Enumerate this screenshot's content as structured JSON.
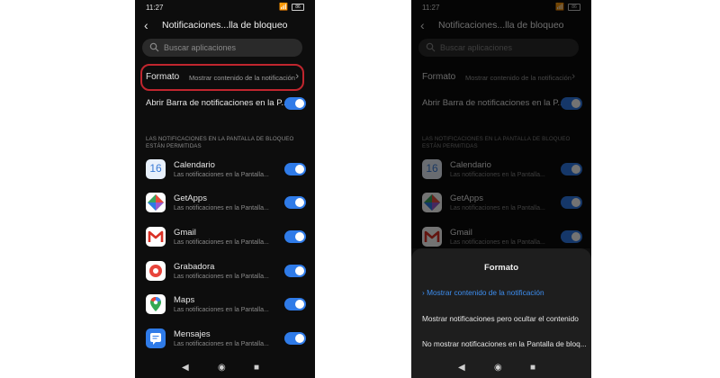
{
  "status": {
    "time": "11:27",
    "battery": "86"
  },
  "screen": {
    "title": "Notificaciones...lla de bloqueo",
    "search_placeholder": "Buscar aplicaciones",
    "formato_label": "Formato",
    "formato_value": "Mostrar contenido de la notificación",
    "open_bar_label": "Abrir Barra de notificaciones en la P...",
    "section_header": "LAS NOTIFICACIONES EN LA PANTALLA DE BLOQUEO ESTÁN PERMITIDAS",
    "apps": [
      {
        "name": "Calendario",
        "subtitle": "Las notificaciones en la Pantalla...",
        "enabled": true
      },
      {
        "name": "GetApps",
        "subtitle": "Las notificaciones en la Pantalla...",
        "enabled": true
      },
      {
        "name": "Gmail",
        "subtitle": "Las notificaciones en la Pantalla...",
        "enabled": true
      },
      {
        "name": "Grabadora",
        "subtitle": "Las notificaciones en la Pantalla...",
        "enabled": true
      },
      {
        "name": "Maps",
        "subtitle": "Las notificaciones en la Pantalla...",
        "enabled": true
      },
      {
        "name": "Mensajes",
        "subtitle": "Las notificaciones en la Pantalla...",
        "enabled": true
      }
    ],
    "calendar_day": "16"
  },
  "sheet": {
    "title": "Formato",
    "options": [
      "Mostrar contenido de la notificación",
      "Mostrar notificaciones pero ocultar el contenido",
      "No mostrar notificaciones en la Pantalla de bloq..."
    ],
    "selected_index": 0
  },
  "colors": {
    "accent": "#2f7be8",
    "highlight_box": "#c0262e",
    "background": "#0d0d0d",
    "sheet": "#1e1e1e"
  }
}
